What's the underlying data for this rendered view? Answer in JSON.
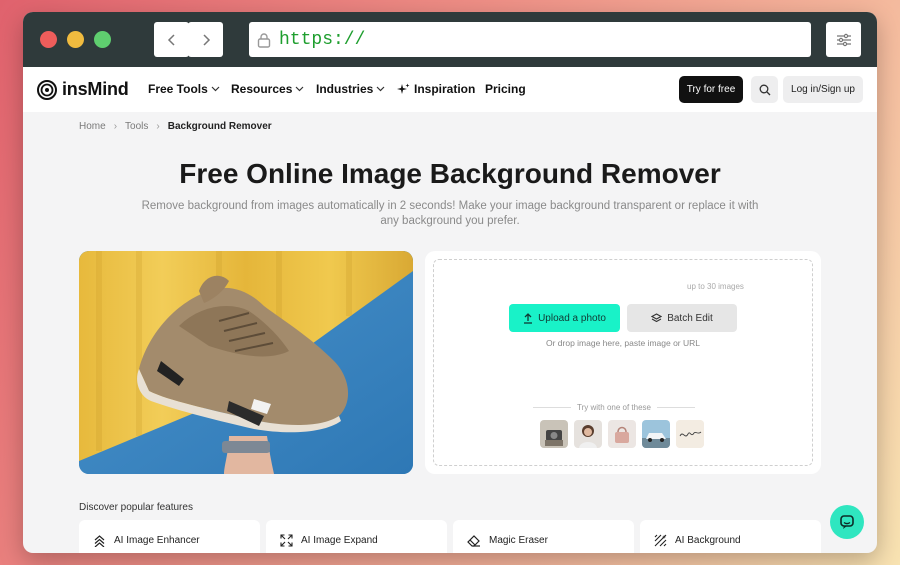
{
  "browser": {
    "url": "https://"
  },
  "brand": {
    "name": "insMind"
  },
  "nav": {
    "items": [
      "Free Tools",
      "Resources",
      "Industries",
      "Inspiration",
      "Pricing"
    ],
    "try_free": "Try for free",
    "login": "Log in/Sign up"
  },
  "breadcrumb": {
    "home": "Home",
    "tools": "Tools",
    "current": "Background Remover"
  },
  "hero": {
    "title": "Free Online Image Background Remover",
    "subtitle": "Remove background from images automatically in 2 seconds! Make your image background transparent or replace it with any background you prefer."
  },
  "upload": {
    "upload_label": "Upload a photo",
    "batch_label": "Batch Edit",
    "batch_note": "up to 30 images",
    "drop_hint": "Or drop image here, paste image or URL",
    "try_label": "Try with one of these",
    "sample_signature": "insMind"
  },
  "features": {
    "heading": "Discover popular features",
    "items": [
      "AI Image Enhancer",
      "AI Image Expand",
      "Magic Eraser",
      "AI Background"
    ]
  },
  "colors": {
    "accent": "#19f2c8",
    "chrome": "#2f3a3b",
    "dark": "#111111"
  }
}
